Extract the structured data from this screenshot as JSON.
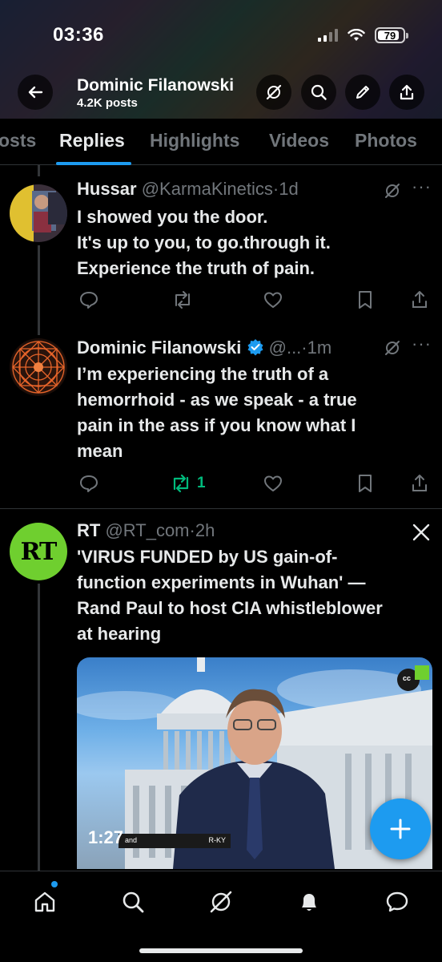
{
  "status": {
    "time": "03:36",
    "battery": "79"
  },
  "header": {
    "name": "Dominic Filanowski",
    "post_count": "4.2K posts"
  },
  "tabs": [
    "osts",
    "Replies",
    "Highlights",
    "Videos",
    "Photos"
  ],
  "tweets": [
    {
      "name": "Hussar",
      "handle": "@KarmaKinetics",
      "time": "·1d",
      "lines": [
        "I showed you the door.",
        "It's up to you, to go.through it.",
        "Experience the truth of pain."
      ],
      "reposts": ""
    },
    {
      "name": "Dominic Filanowski",
      "handle": "@...",
      "time": "·1m",
      "lines": [
        "I’m experiencing the truth of a",
        "hemorrhoid - as we speak - a true",
        "pain in the ass if you know what I",
        "mean"
      ],
      "reposts": "1"
    },
    {
      "name": "RT",
      "handle": "@RT_com",
      "time": "·2h",
      "avatar_text": "RT",
      "lines": [
        "'VIRUS FUNDED by US gain-of-",
        "function experiments in Wuhan' —",
        "Rand Paul to host CIA whistleblower",
        "at hearing"
      ],
      "video": {
        "duration": "1:27",
        "caption_left": "and",
        "caption_right": "R-KY",
        "cc": "cc"
      }
    }
  ],
  "colors": {
    "accent": "#1d9bf0",
    "repost_green": "#00ba7c",
    "muted": "#71767b",
    "rt_green": "#6fcf2f"
  },
  "icons": [
    "back-arrow-icon",
    "grok-icon",
    "search-icon",
    "edit-pen-icon",
    "share-icon",
    "reply-icon",
    "repost-icon",
    "like-icon",
    "bookmark-icon",
    "share-icon",
    "x-logo-icon",
    "home-icon",
    "search-icon",
    "grok-icon",
    "bell-icon",
    "message-icon",
    "plus-icon"
  ]
}
